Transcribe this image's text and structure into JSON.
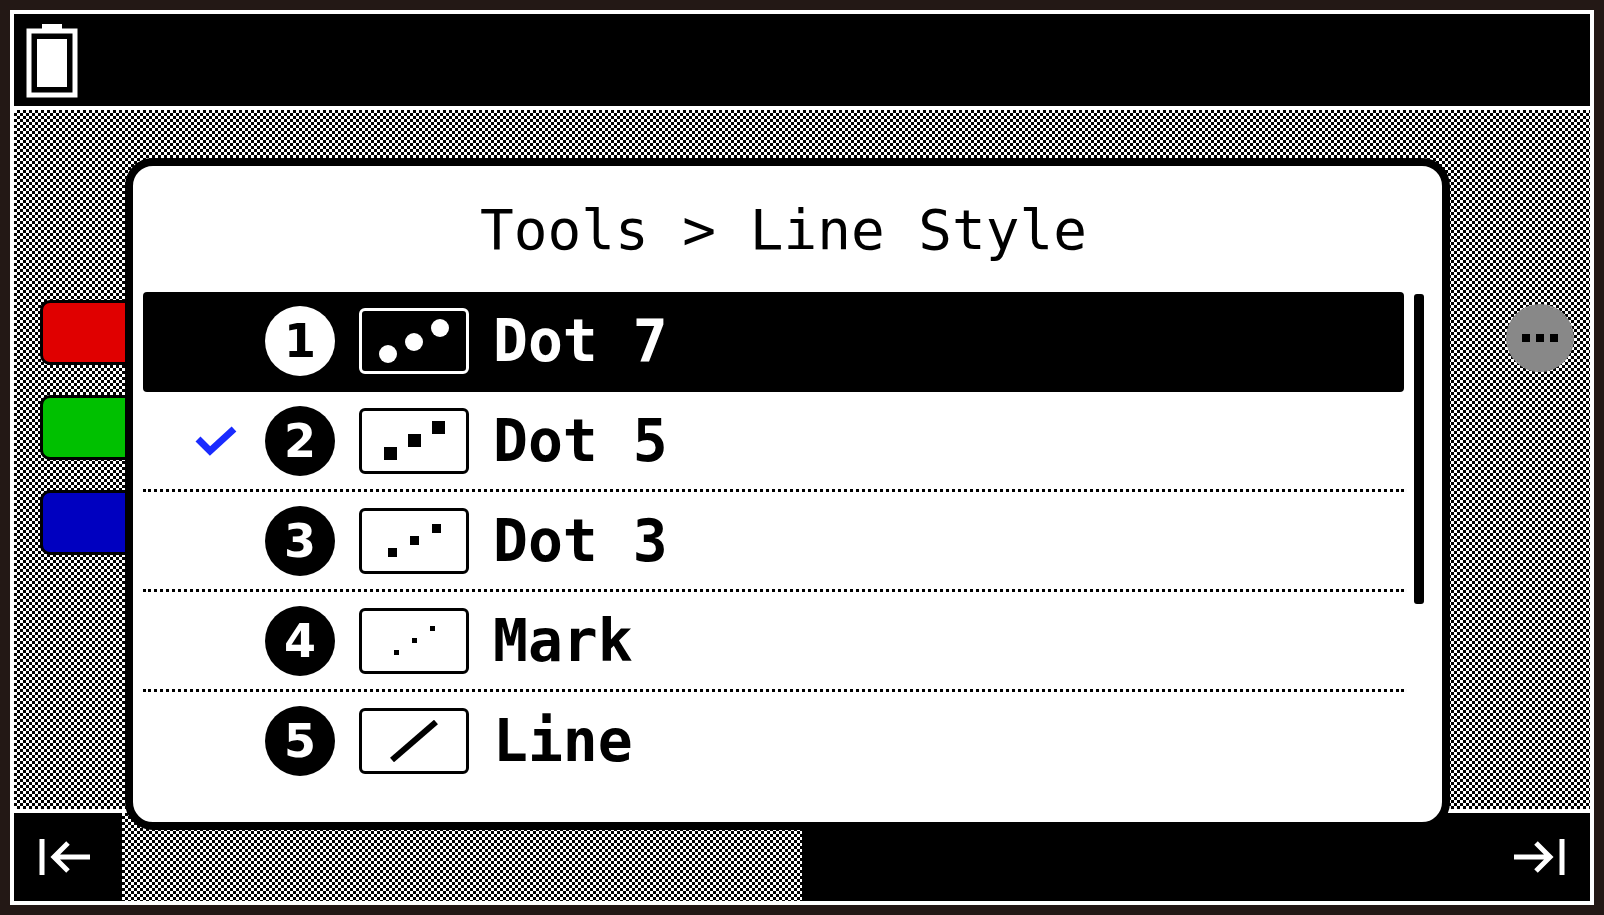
{
  "dialog": {
    "title": "Tools > Line Style",
    "items": [
      {
        "number": "1",
        "label": "Dot 7",
        "kind": "dot7",
        "selected": true,
        "checked": false
      },
      {
        "number": "2",
        "label": "Dot 5",
        "kind": "dot5",
        "selected": false,
        "checked": true
      },
      {
        "number": "3",
        "label": "Dot 3",
        "kind": "dot3",
        "selected": false,
        "checked": false
      },
      {
        "number": "4",
        "label": "Mark",
        "kind": "mark",
        "selected": false,
        "checked": false
      },
      {
        "number": "5",
        "label": "Line",
        "kind": "line",
        "selected": false,
        "checked": false
      }
    ]
  },
  "background_swatches": [
    {
      "color": "#e00000"
    },
    {
      "color": "#00c000"
    },
    {
      "color": "#0000c0"
    }
  ]
}
